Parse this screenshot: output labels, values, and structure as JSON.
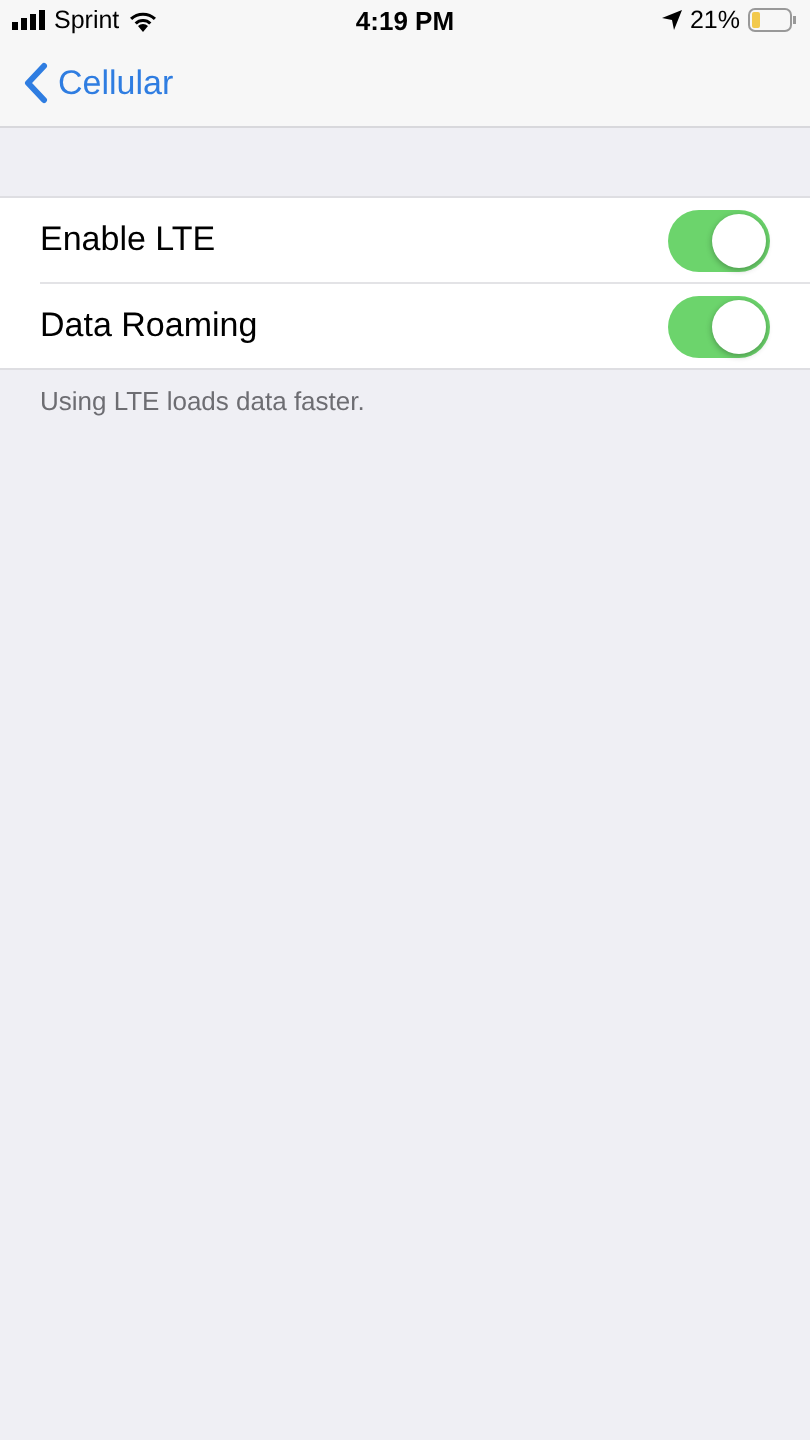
{
  "status_bar": {
    "carrier": "Sprint",
    "time": "4:19 PM",
    "battery": "21%"
  },
  "nav_bar": {
    "back_label": "Cellular"
  },
  "settings": [
    {
      "label": "Enable LTE",
      "on": true
    },
    {
      "label": "Data Roaming",
      "on": true
    }
  ],
  "footer": "Using LTE loads data faster."
}
